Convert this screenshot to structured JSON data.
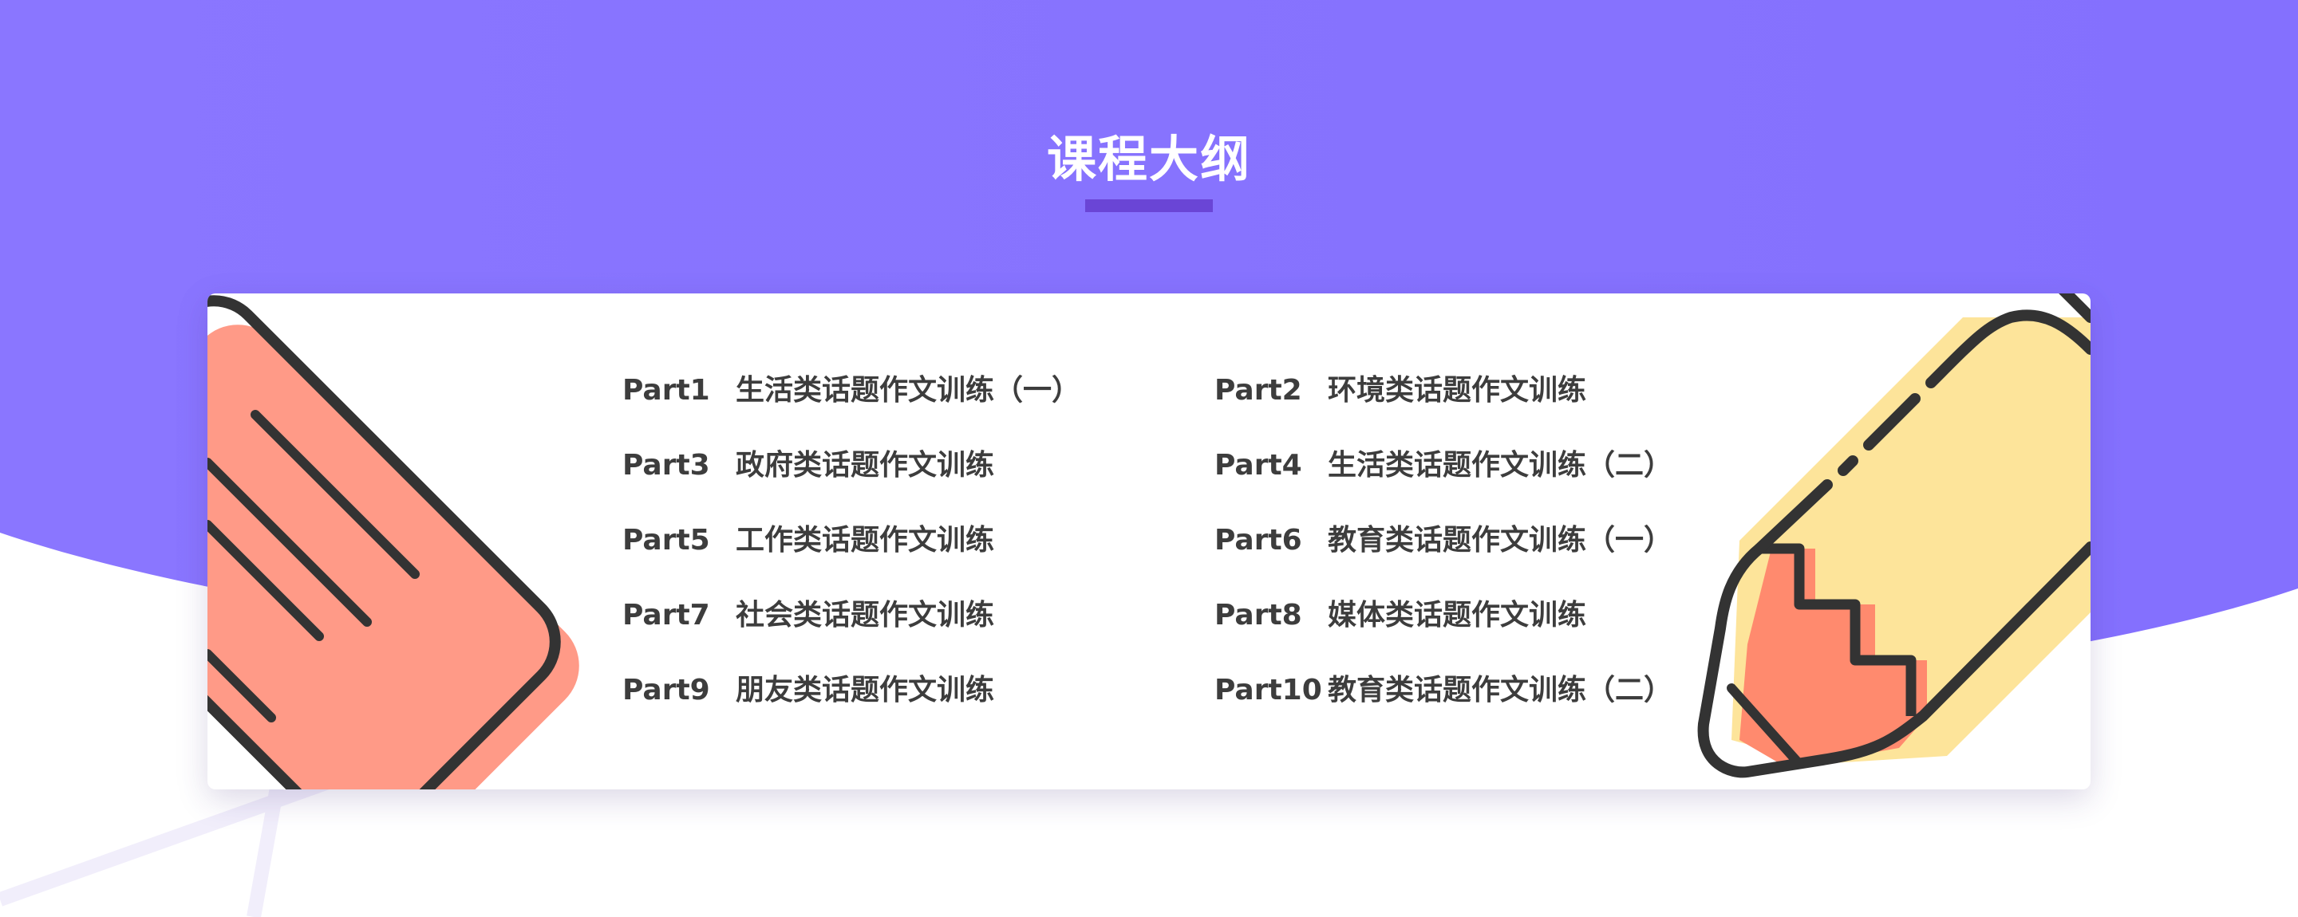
{
  "page": {
    "title": "课程大纲"
  },
  "outline": {
    "items": [
      {
        "part": "Part1",
        "topic": "生活类话题作文训练（一）"
      },
      {
        "part": "Part2",
        "topic": "环境类话题作文训练"
      },
      {
        "part": "Part3",
        "topic": "政府类话题作文训练"
      },
      {
        "part": "Part4",
        "topic": "生活类话题作文训练（二）"
      },
      {
        "part": "Part5",
        "topic": "工作类话题作文训练"
      },
      {
        "part": "Part6",
        "topic": "教育类话题作文训练（一）"
      },
      {
        "part": "Part7",
        "topic": "社会类话题作文训练"
      },
      {
        "part": "Part8",
        "topic": "媒体类话题作文训练"
      },
      {
        "part": "Part9",
        "topic": "朋友类话题作文训练"
      },
      {
        "part": "Part10",
        "topic": "教育类话题作文训练（二）"
      }
    ]
  },
  "colors": {
    "header_purple": "#8877ff",
    "underline_purple": "#6a45d6",
    "text_dark": "#3d3d3d",
    "card_white": "#ffffff",
    "notebook_salmon": "#ff9a87",
    "pencil_yellow": "#fde49a",
    "pencil_tip_salmon": "#ff8a6e",
    "stroke_dark": "#333333"
  },
  "icons": {
    "left_decoration": "notebook-icon",
    "right_decoration": "pencil-icon"
  }
}
